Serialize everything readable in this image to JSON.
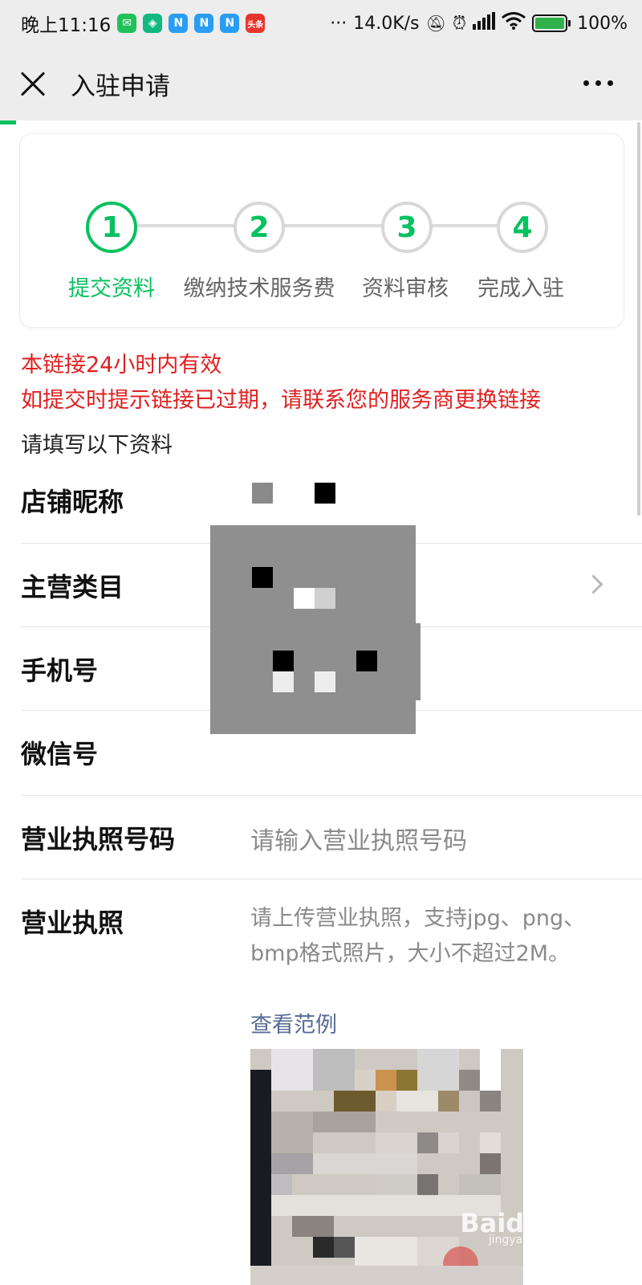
{
  "status_bar": {
    "time": "晚上11:16",
    "app_icons": [
      {
        "name": "wechat-icon",
        "glyph": "✉",
        "color": "#22c05a"
      },
      {
        "name": "shield-app-icon",
        "glyph": "◈",
        "color": "#11b981"
      },
      {
        "name": "n-app-icon",
        "glyph": "N",
        "color": "#2a9df4"
      },
      {
        "name": "n-app-icon",
        "glyph": "N",
        "color": "#2a9df4"
      },
      {
        "name": "n-app-icon",
        "glyph": "N",
        "color": "#2a9df4"
      },
      {
        "name": "toutiao-icon",
        "glyph": "头条",
        "color": "#e8352b"
      }
    ],
    "more": "···",
    "net_speed": "14.0K/s",
    "battery": "100%"
  },
  "nav": {
    "title": "入驻申请"
  },
  "steps": [
    {
      "number": "1",
      "label": "提交资料",
      "active": true
    },
    {
      "number": "2",
      "label": "缴纳技术服务费",
      "active": false
    },
    {
      "number": "3",
      "label": "资料审核",
      "active": false
    },
    {
      "number": "4",
      "label": "完成入驻",
      "active": false
    }
  ],
  "notice": {
    "line1": "本链接24小时内有效",
    "line2": "如提交时提示链接已过期，请联系您的服务商更换链接"
  },
  "form": {
    "title": "请填写以下资料",
    "fields": [
      {
        "label": "店铺昵称",
        "value": ""
      },
      {
        "label": "主营类目",
        "value": ""
      },
      {
        "label": "手机号",
        "value": ""
      },
      {
        "label": "微信号",
        "value": ""
      },
      {
        "label": "营业执照号码",
        "placeholder": "请输入营业执照号码"
      },
      {
        "label": "营业执照"
      }
    ],
    "license_desc": "请上传营业执照，支持jpg、png、bmp格式照片，大小不超过2M。",
    "example_link": "查看范例"
  },
  "watermark": {
    "text": "Baidu经验",
    "sub": "jingyan.baidu.com"
  },
  "colors": {
    "accent": "#07c160",
    "warning": "#e02020",
    "link": "#576b95"
  }
}
